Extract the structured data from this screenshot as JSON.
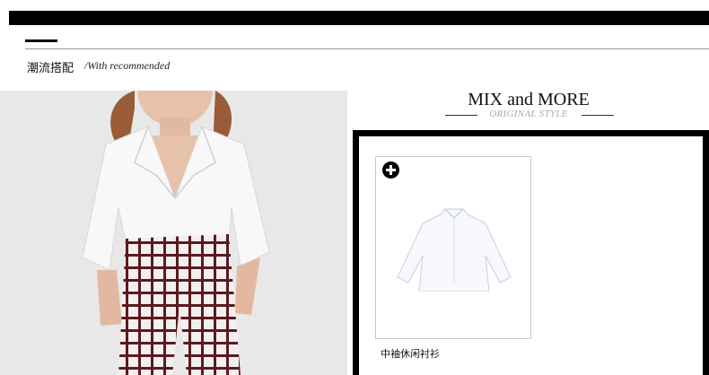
{
  "section": {
    "title": "潮流搭配",
    "subtitle": "/With recommended"
  },
  "mix": {
    "title": "MIX and MORE",
    "subtitle": "ORIGINAL STYLE"
  },
  "product": {
    "name": "中袖休闲衬衫",
    "add_icon": "plus-circle-icon"
  },
  "colors": {
    "bar": "#000000",
    "pants_grid": "#5a1a1f"
  }
}
